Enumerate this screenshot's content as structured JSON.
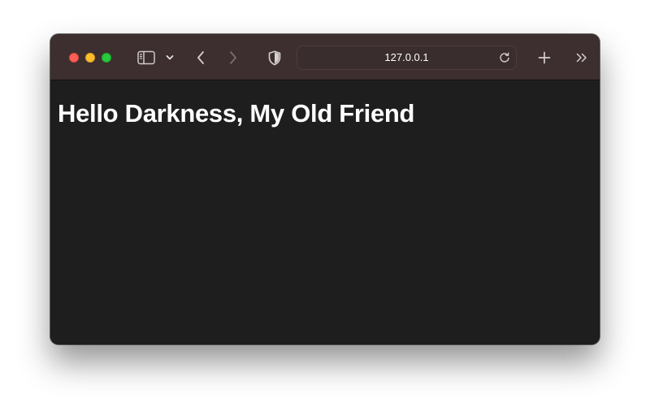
{
  "browser": {
    "address_bar": {
      "url": "127.0.0.1"
    },
    "toolbar_icons": [
      "sidebar-icon",
      "chevron-down-icon",
      "back-arrow-icon",
      "forward-arrow-icon",
      "shield-icon",
      "reload-icon",
      "plus-icon",
      "double-chevron-right-icon"
    ],
    "colors": {
      "toolbar": "#3d2f2f",
      "content_background": "#1e1e1e",
      "close": "#ff5f57",
      "minimize": "#febc2e",
      "maximize": "#28c840"
    }
  },
  "page": {
    "heading": "Hello Darkness, My Old Friend"
  }
}
